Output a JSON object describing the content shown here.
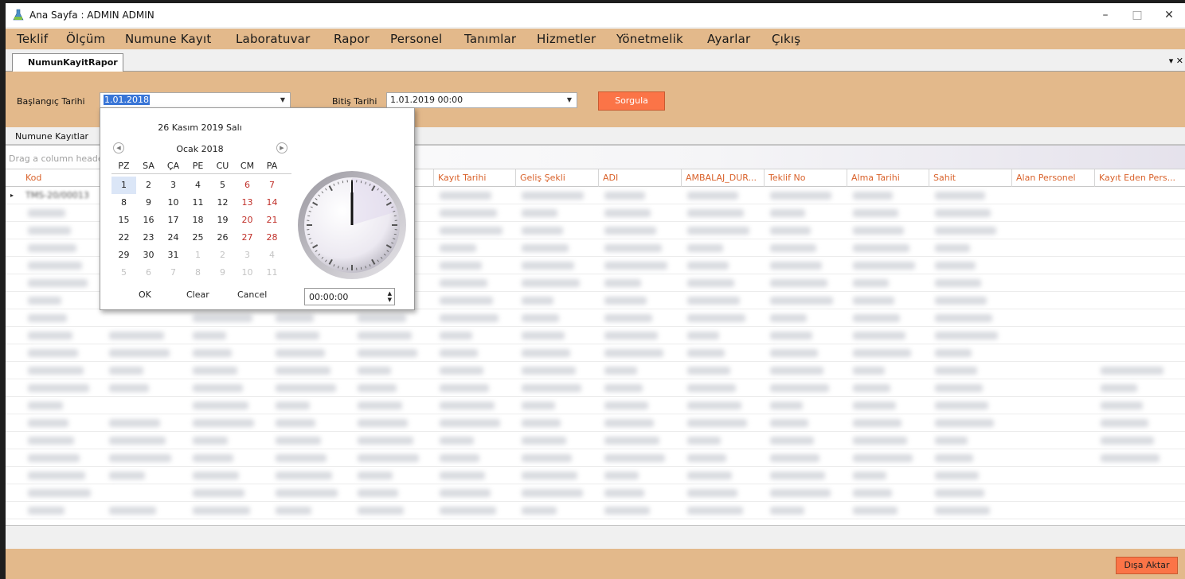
{
  "window": {
    "title": "Ana Sayfa : ADMIN ADMIN",
    "minimize": "–",
    "maximize": "□",
    "close": "✕"
  },
  "menu": [
    "Teklif",
    "Ölçüm",
    "Numune Kayıt",
    "Laboratuvar",
    "Rapor",
    "Personel",
    "Tanımlar",
    "Hizmetler",
    "Yönetmelik",
    "Ayarlar",
    "Çıkış"
  ],
  "tab": {
    "label": "NumunKayitRapor",
    "menu_glyph": "▾ ✕"
  },
  "filters": {
    "start_label": "Başlangıç Tarihi",
    "start_value": "1.01.2018",
    "end_label": "Bitiş Tarihi",
    "end_value": "1.01.2019 00:00",
    "query_button": "Sorgula"
  },
  "group": {
    "title": "Numune Kayıtlar",
    "drag_hint": "Drag a column header here to group by that column"
  },
  "columns": [
    "Kod",
    "",
    "",
    "",
    "",
    "Kayıt Tarihi",
    "Geliş Şekli",
    "ADI",
    "AMBALAJ_DUR...",
    "Teklif No",
    "Alma Tarihi",
    "Sahit",
    "Alan Personel",
    "Kayıt Eden Pers..."
  ],
  "first_row_code": "TMS-20/00013",
  "calendar": {
    "today": "26 Kasım 2019 Salı",
    "month": "Ocak 2018",
    "prev": "◀",
    "next": "▶",
    "day_headers": [
      "PZ",
      "SA",
      "ÇA",
      "PE",
      "CU",
      "CM",
      "PA"
    ],
    "weeks": [
      [
        "1",
        "2",
        "3",
        "4",
        "5",
        "6",
        "7"
      ],
      [
        "8",
        "9",
        "10",
        "11",
        "12",
        "13",
        "14"
      ],
      [
        "15",
        "16",
        "17",
        "18",
        "19",
        "20",
        "21"
      ],
      [
        "22",
        "23",
        "24",
        "25",
        "26",
        "27",
        "28"
      ],
      [
        "29",
        "30",
        "31",
        "1",
        "2",
        "3",
        "4"
      ],
      [
        "5",
        "6",
        "7",
        "8",
        "9",
        "10",
        "11"
      ]
    ],
    "selected_day": "1",
    "ok": "OK",
    "clear": "Clear",
    "cancel": "Cancel",
    "time": "00:00:00"
  },
  "export_button": "Dışa Aktar",
  "colors": {
    "accent": "#e3b98b",
    "button": "#fb7447",
    "header_text": "#d9622b"
  }
}
